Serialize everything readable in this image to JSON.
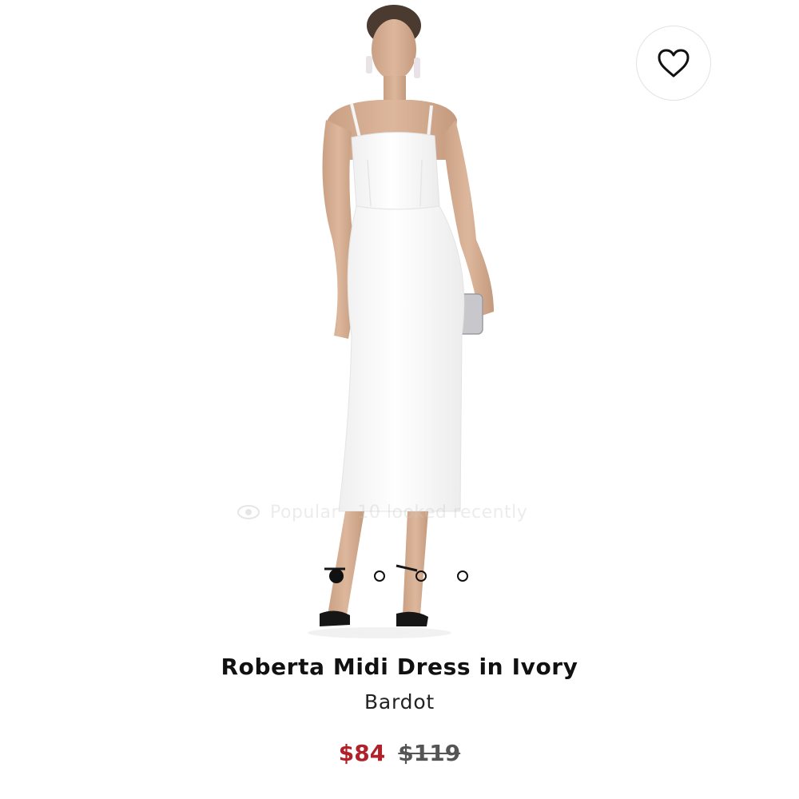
{
  "product": {
    "title": "Roberta Midi Dress in Ivory",
    "brand": "Bardot",
    "sale_price": "$84",
    "original_price": "$119",
    "sale_color": "#b0212a"
  },
  "overlay": {
    "popular_text": "Popular - 10 looked recently"
  },
  "carousel": {
    "total": 4,
    "active_index": 0
  },
  "wishlist": {
    "icon": "heart-outline-icon"
  }
}
